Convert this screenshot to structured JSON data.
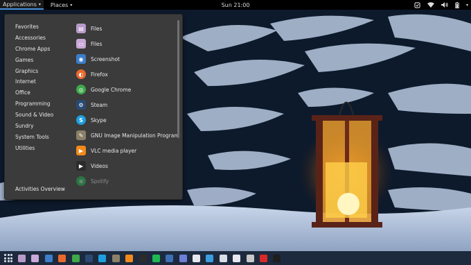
{
  "topbar": {
    "applications_label": "Applications",
    "places_label": "Places",
    "clock": "Sun 21:00",
    "tray_icons": [
      "screenshot-icon",
      "wifi-icon",
      "volume-icon",
      "battery-icon",
      "chevron-down-icon"
    ]
  },
  "menu": {
    "categories": [
      "Favorites",
      "Accessories",
      "Chrome Apps",
      "Games",
      "Graphics",
      "Internet",
      "Office",
      "Programming",
      "Sound & Video",
      "Sundry",
      "System Tools",
      "Utilities"
    ],
    "activities_label": "Activities Overview",
    "apps": [
      {
        "label": "Files",
        "icon": "files-icon",
        "color": "#b89ac9"
      },
      {
        "label": "Files",
        "icon": "folder-icon",
        "color": "#c9a9d6"
      },
      {
        "label": "Screenshot",
        "icon": "camera-icon",
        "color": "#3d7dc9"
      },
      {
        "label": "Firefox",
        "icon": "firefox-icon",
        "color": "#e9692c"
      },
      {
        "label": "Google Chrome",
        "icon": "chrome-icon",
        "color": "#3fa84a"
      },
      {
        "label": "Steam",
        "icon": "steam-icon",
        "color": "#2a4a73"
      },
      {
        "label": "Skype",
        "icon": "skype-icon",
        "color": "#1e9ee0"
      },
      {
        "label": "GNU Image Manipulation Program",
        "icon": "gimp-icon",
        "color": "#8b8068"
      },
      {
        "label": "VLC media player",
        "icon": "vlc-icon",
        "color": "#f28a1a"
      },
      {
        "label": "Videos",
        "icon": "videos-icon",
        "color": "#2b2b2b"
      },
      {
        "label": "Spotify",
        "icon": "spotify-icon",
        "color": "#1db954"
      }
    ]
  },
  "dock": {
    "icons": [
      {
        "name": "files-icon",
        "color": "#b89ac9"
      },
      {
        "name": "folder-icon",
        "color": "#c9a9d6"
      },
      {
        "name": "screenshot-icon",
        "color": "#3d7dc9"
      },
      {
        "name": "firefox-icon",
        "color": "#e9692c"
      },
      {
        "name": "chrome-icon",
        "color": "#3fa84a"
      },
      {
        "name": "steam-icon",
        "color": "#2a4a73"
      },
      {
        "name": "skype-icon",
        "color": "#1e9ee0"
      },
      {
        "name": "gimp-icon",
        "color": "#8b8068"
      },
      {
        "name": "vlc-icon",
        "color": "#f28a1a"
      },
      {
        "name": "videos-icon",
        "color": "#2b2b2b"
      },
      {
        "name": "spotify-icon",
        "color": "#1db954"
      },
      {
        "name": "terminal-app-icon",
        "color": "#3c6fb5"
      },
      {
        "name": "notes-icon",
        "color": "#6e7fd8"
      },
      {
        "name": "document-icon",
        "color": "#e6e6ef"
      },
      {
        "name": "image-viewer-icon",
        "color": "#3b9de0"
      },
      {
        "name": "settings-icon",
        "color": "#d9dde6"
      },
      {
        "name": "calendar-icon",
        "color": "#e7e7ef"
      },
      {
        "name": "disks-icon",
        "color": "#c8c8c8"
      },
      {
        "name": "tweaks-icon",
        "color": "#d82828"
      },
      {
        "name": "terminal-icon",
        "color": "#1e1e1e"
      }
    ]
  }
}
